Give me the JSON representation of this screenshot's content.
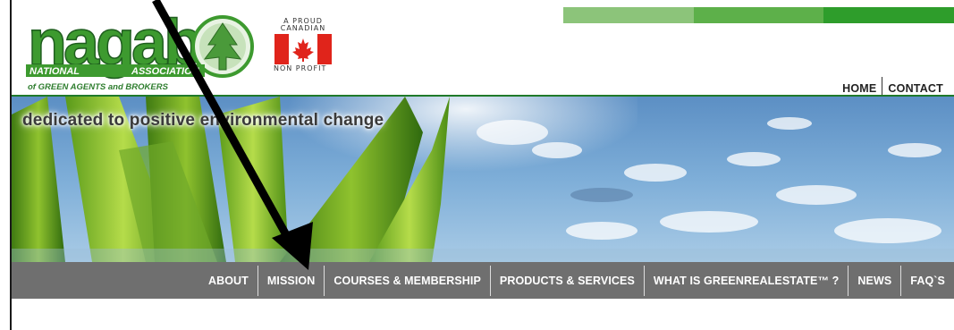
{
  "logo": {
    "wordmark": "nagab",
    "line1_left": "NATIONAL",
    "line1_right": "ASSOCIATION",
    "line2": "of GREEN AGENTS and BROKERS",
    "brand_green": "#3d9a2f",
    "dark_green": "#1f6b1f"
  },
  "badge": {
    "top_text_1": "A PROUD",
    "top_text_2": "CANADIAN",
    "bottom_text": "NON PROFIT",
    "flag_red": "#e0241b"
  },
  "topbar_colors": [
    "#8cc47a",
    "#5db04a",
    "#2e9d2b"
  ],
  "top_nav": {
    "items": [
      "HOME",
      "CONTACT"
    ]
  },
  "banner": {
    "tagline": "dedicated to positive environmental change"
  },
  "main_nav": {
    "items": [
      "ABOUT",
      "MISSION",
      "COURSES & MEMBERSHIP",
      "PRODUCTS & SERVICES",
      "WHAT IS GREENREALESTATE™ ?",
      "NEWS",
      "FAQ`S"
    ]
  }
}
